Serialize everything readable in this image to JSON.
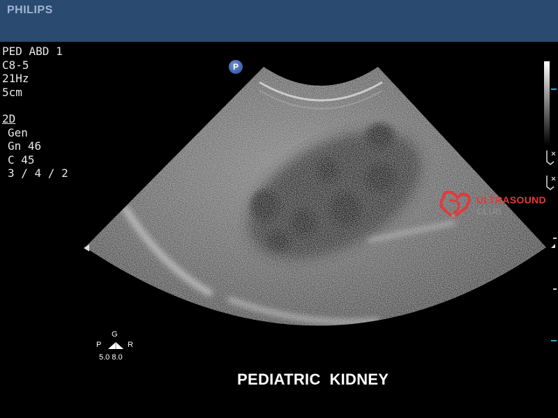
{
  "header": {
    "brand": "PHILIPS"
  },
  "params": {
    "preset": "PED ABD 1",
    "probe": "C8-5",
    "frame_rate": "21Hz",
    "depth": "5cm",
    "mode": "2D",
    "mode_items": [
      "Gen",
      "Gn 46",
      "C 45",
      "3 / 4 / 2"
    ]
  },
  "badge": {
    "label": "P"
  },
  "watermark": {
    "line1": "ULTRASOUND",
    "line2": "CLUB",
    "accent": "#e23a3a"
  },
  "orientation": {
    "g": "G",
    "p": "P",
    "r": "R",
    "freq": "5.0  8.0"
  },
  "caption": "PEDIATRIC  KIDNEY",
  "colors": {
    "header_bg": "#2b4a70",
    "marker": "#2fa4d8"
  }
}
